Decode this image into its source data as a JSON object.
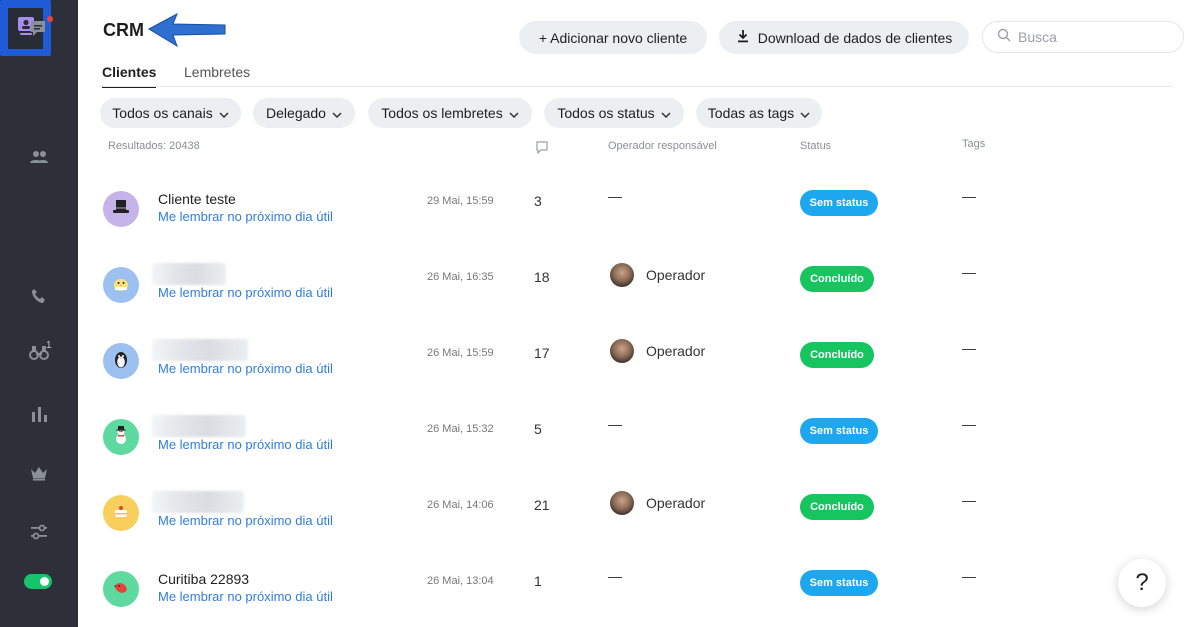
{
  "header": {
    "title": "CRM",
    "add_client_label": "+ Adicionar novo cliente",
    "download_label": "Download de dados de clientes",
    "search_placeholder": "Busca"
  },
  "tabs": [
    {
      "label": "Clientes",
      "active": true
    },
    {
      "label": "Lembretes",
      "active": false
    }
  ],
  "filters": [
    "Todos os canais",
    "Delegado",
    "Todos os lembretes",
    "Todos os status",
    "Todas as tags"
  ],
  "table": {
    "results_label": "Resultados: 20438",
    "col_operator": "Operador responsável",
    "col_status": "Status",
    "col_tags": "Tags"
  },
  "rows": [
    {
      "name": "Cliente teste",
      "reminder": "Me lembrar no próximo dia útil",
      "date": "29 Mai, 15:59",
      "messages": "3",
      "operator": "—",
      "status": "Sem status",
      "tags": "—",
      "avatar_icon": "top-hat-icon",
      "avatar_color": "#c5b3ea"
    },
    {
      "name": "",
      "reminder": "Me lembrar no próximo dia útil",
      "date": "26 Mai, 16:35",
      "messages": "18",
      "operator": "Operador",
      "status": "Concluído",
      "tags": "—",
      "avatar_icon": "chick-icon",
      "avatar_color": "#9cc0f0"
    },
    {
      "name": "",
      "reminder": "Me lembrar no próximo dia útil",
      "date": "26 Mai, 15:59",
      "messages": "17",
      "operator": "Operador",
      "status": "Concluído",
      "tags": "—",
      "avatar_icon": "penguin-icon",
      "avatar_color": "#9cc0f0"
    },
    {
      "name": "",
      "reminder": "Me lembrar no próximo dia útil",
      "date": "26 Mai, 15:32",
      "messages": "5",
      "operator": "—",
      "status": "Sem status",
      "tags": "—",
      "avatar_icon": "snowman-icon",
      "avatar_color": "#5fd9a0"
    },
    {
      "name": "",
      "reminder": "Me lembrar no próximo dia útil",
      "date": "26 Mai, 14:06",
      "messages": "21",
      "operator": "Operador",
      "status": "Concluído",
      "tags": "—",
      "avatar_icon": "cake-icon",
      "avatar_color": "#f8cf5c"
    },
    {
      "name": "Curitiba 22893",
      "reminder": "Me lembrar no próximo dia útil",
      "date": "26 Mai, 13:04",
      "messages": "1",
      "operator": "—",
      "status": "Sem status",
      "tags": "—",
      "avatar_icon": "bird-icon",
      "avatar_color": "#5fd9a0"
    }
  ],
  "sidebar": {
    "reminders_badge": "1"
  },
  "help_label": "?",
  "colors": {
    "sidebar_bg": "#2d3039",
    "active_highlight": "#1f5bd6",
    "link": "#2f7ed8",
    "status_none": "#1da7f0",
    "status_done": "#16c560"
  }
}
